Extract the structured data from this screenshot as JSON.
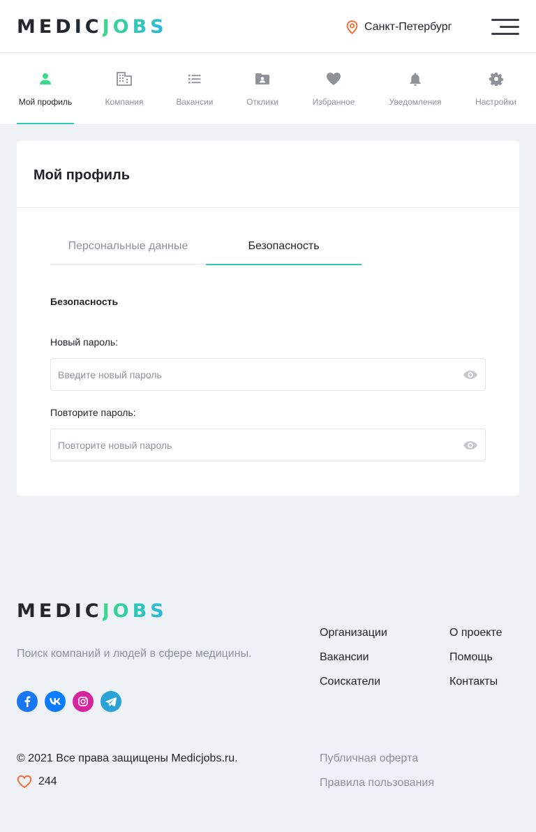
{
  "header": {
    "logo_part1": "MEDIC",
    "logo_part2": "JOBS",
    "city": "Санкт-Петербург",
    "menu_icon": "hamburger-icon"
  },
  "nav": {
    "active_color": "#2fc7b5",
    "items": [
      {
        "label": "Мой профиль",
        "icon": "user-icon",
        "active": true
      },
      {
        "label": "Компания",
        "icon": "building-icon"
      },
      {
        "label": "Вакансии",
        "icon": "list-icon"
      },
      {
        "label": "Отклики",
        "icon": "folder-user-icon"
      },
      {
        "label": "Избранное",
        "icon": "heart-icon"
      },
      {
        "label": "Уведомления",
        "icon": "bell-icon"
      },
      {
        "label": "Настройки",
        "icon": "gear-icon"
      }
    ]
  },
  "profile": {
    "title": "Мой профиль",
    "tabs": [
      {
        "label": "Персональные данные"
      },
      {
        "label": "Безопасность",
        "active": true
      }
    ],
    "section_title": "Безопасность",
    "new_password": {
      "label": "Новый пароль:",
      "placeholder": "Введите новый пароль",
      "icon": "eye-icon"
    },
    "repeat_password": {
      "label": "Повторите пароль:",
      "placeholder": "Повторите новый пароль",
      "icon": "eye-icon"
    }
  },
  "footer": {
    "logo_part1": "MEDIC",
    "logo_part2": "JOBS",
    "tagline": "Поиск компаний и людей в сфере медицины.",
    "socials": [
      {
        "icon": "facebook-icon",
        "color": "#1877f2"
      },
      {
        "icon": "vk-icon",
        "color": "#0a7cff"
      },
      {
        "icon": "instagram-icon",
        "color": "#d6249f"
      },
      {
        "icon": "telegram-icon",
        "color": "#2aa3d8"
      }
    ],
    "links_col1": [
      "Организации",
      "Вакансии",
      "Соискатели"
    ],
    "links_col2": [
      "О проекте",
      "Помощь",
      "Контакты"
    ],
    "copyright": "© 2021 Все права защищены Medicjobs.ru.",
    "likes_count": "244",
    "legal": [
      "Публичная оферта",
      "Правила пользования"
    ]
  }
}
